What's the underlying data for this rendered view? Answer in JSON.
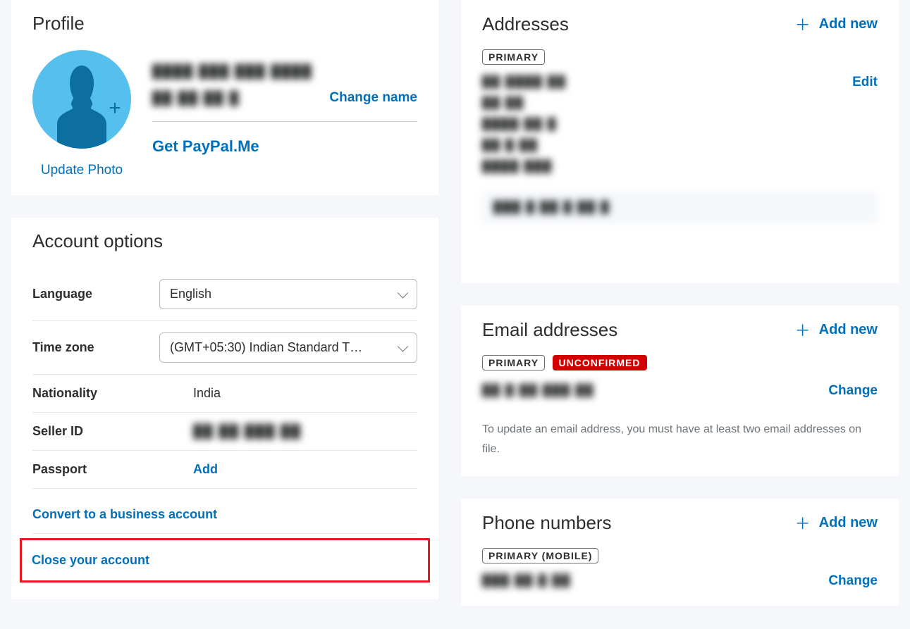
{
  "profile": {
    "heading": "Profile",
    "name_line1_blurred": "████ ███ ███ ████",
    "name_line2_blurred": "██ ██ ██ █",
    "change_name": "Change name",
    "get_ppme": "Get PayPal.Me",
    "update_photo": "Update Photo"
  },
  "account_options": {
    "heading": "Account options",
    "language_label": "Language",
    "language_value": "English",
    "timezone_label": "Time zone",
    "timezone_value": "(GMT+05:30) Indian Standard T…",
    "nationality_label": "Nationality",
    "nationality_value": "India",
    "seller_id_label": "Seller ID",
    "seller_id_value_blurred": "██ ██ ███ ██",
    "passport_label": "Passport",
    "passport_add": "Add",
    "convert_link": "Convert to a business account",
    "close_link": "Close your account"
  },
  "addresses": {
    "heading": "Addresses",
    "add_new": "Add new",
    "primary_badge": "PRIMARY",
    "edit": "Edit",
    "line1": "██ ████ ██",
    "line2": "██ ██",
    "line3": "████ ██ █",
    "line4": "██ █ ██",
    "line5": "████ ███",
    "footer_blurred": "███ █ ██ █ ██  █"
  },
  "emails": {
    "heading": "Email addresses",
    "add_new": "Add new",
    "primary_badge": "PRIMARY",
    "unconfirmed_badge": "UNCONFIRMED",
    "email_blurred": "██ █ ██ ███ ██",
    "change": "Change",
    "info": "To update an email address, you must have at least two email addresses on file."
  },
  "phones": {
    "heading": "Phone numbers",
    "add_new": "Add new",
    "primary_mobile_badge": "PRIMARY (MOBILE)",
    "phone_blurred": "███ ██ █ ██",
    "change": "Change"
  }
}
